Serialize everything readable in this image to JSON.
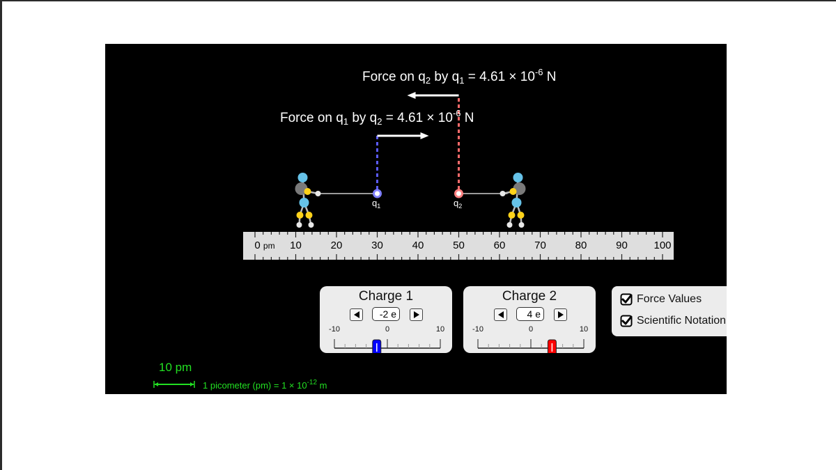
{
  "simulation": {
    "force_on_q2": {
      "prefix": "Force on q",
      "sub_target": "2",
      "by": " by q",
      "sub_source": "1",
      "equals": " = ",
      "mantissa": "4.61",
      "times": " × 10",
      "exponent": "-6",
      "unit": " N",
      "direction": "left"
    },
    "force_on_q1": {
      "prefix": "Force on q",
      "sub_target": "1",
      "by": " by q",
      "sub_source": "2",
      "equals": " = ",
      "mantissa": "4.61",
      "times": " × 10",
      "exponent": "-6",
      "unit": " N",
      "direction": "right"
    },
    "charges": [
      {
        "name": "q",
        "sub": "1",
        "position_pm": 30,
        "color": "#8080ff",
        "dash_color": "#5b5bff"
      },
      {
        "name": "q",
        "sub": "2",
        "position_pm": 50,
        "color": "#ff8080",
        "dash_color": "#ff6b6b"
      }
    ],
    "figure_colors": {
      "head": "#66c2e8",
      "body": "#7a7a7a",
      "joint": "#ffd21a",
      "hand": "#e8e8e8",
      "foot": "#e8e8e8",
      "limb": "#bdbdbd"
    },
    "rope_color": "#9a9a9a",
    "arrow_color": "#ffffff"
  },
  "ruler": {
    "unit": "pm",
    "min": 0,
    "max": 100,
    "labels": [
      "0",
      "10",
      "20",
      "30",
      "40",
      "50",
      "60",
      "70",
      "80",
      "90",
      "100"
    ]
  },
  "charge1_panel": {
    "title": "Charge 1",
    "value_display": "-2 e",
    "value": -2,
    "min": -10,
    "max": 10,
    "min_label": "-10",
    "zero_label": "0",
    "max_label": "10",
    "thumb_color": "#0000ff"
  },
  "charge2_panel": {
    "title": "Charge 2",
    "value_display": "4 e",
    "value": 4,
    "min": -10,
    "max": 10,
    "min_label": "-10",
    "zero_label": "0",
    "max_label": "10",
    "thumb_color": "#ff0000"
  },
  "options": {
    "force_values": {
      "label": "Force Values",
      "checked": true
    },
    "scientific_notation": {
      "label": "Scientific Notation",
      "checked": true
    }
  },
  "scale": {
    "title": "10 pm",
    "note_prefix": "1 picometer (pm) = 1 × 10",
    "note_exponent": "-12",
    "note_suffix": " m",
    "color": "#22e022"
  }
}
